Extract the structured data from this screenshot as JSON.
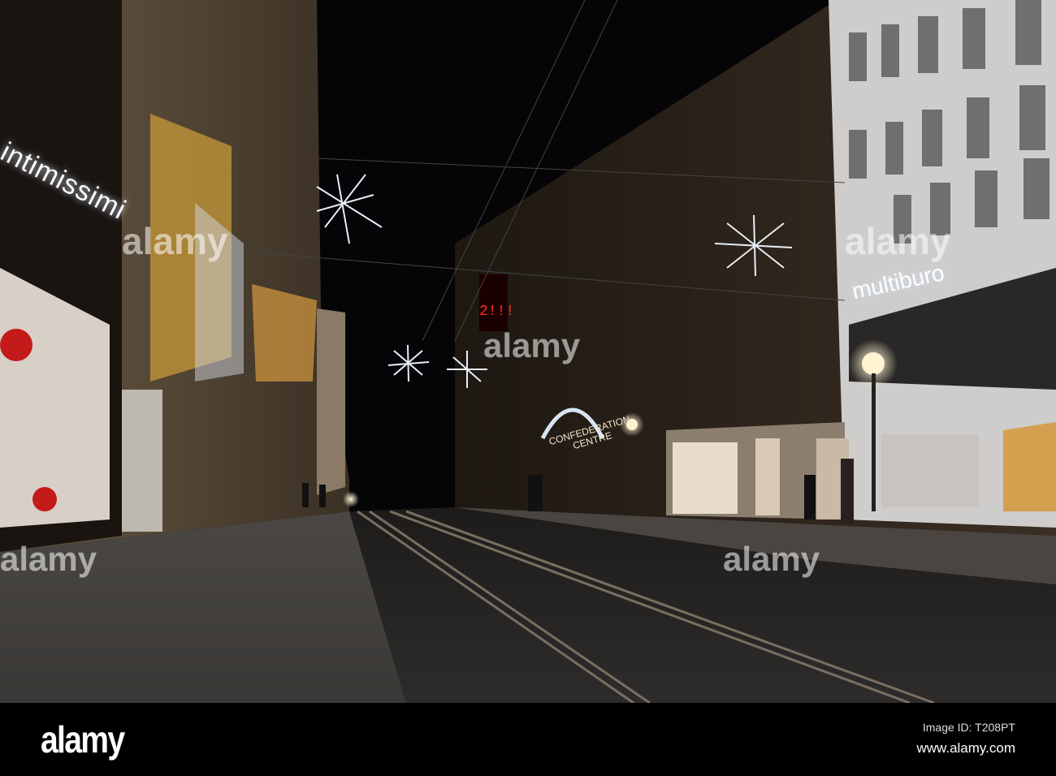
{
  "photo": {
    "signs": {
      "intimissimi": "intimissimi",
      "multiburo": "multiburo",
      "confederation_line1": "CONFEDERATION",
      "confederation_line2": "CENTRE"
    },
    "watermark_text": "alamy"
  },
  "footer": {
    "logo": "alamy",
    "image_id": "Image ID: T208PT",
    "url": "www.alamy.com"
  }
}
